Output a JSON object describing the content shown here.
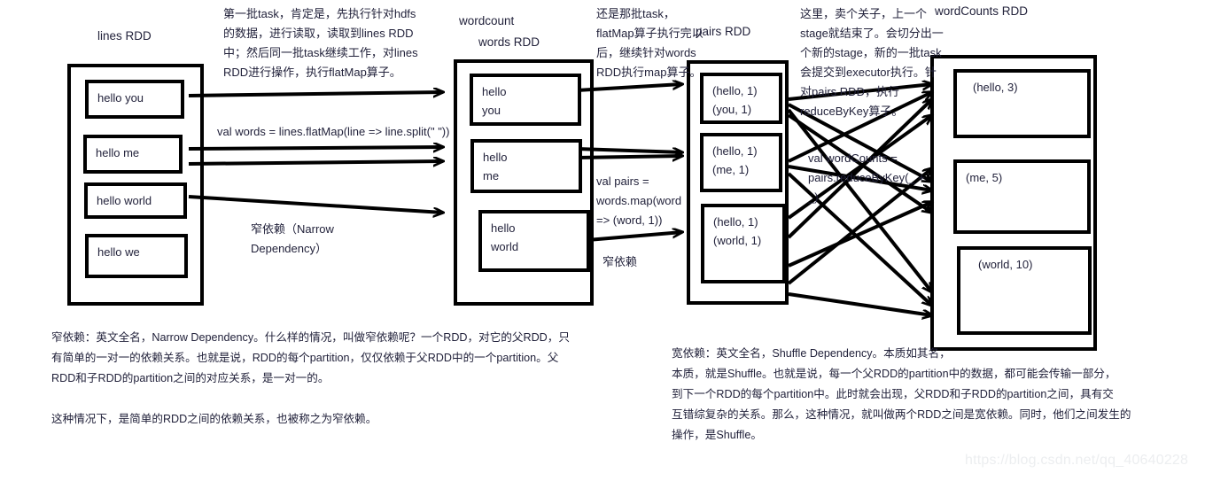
{
  "diagram": {
    "watermark": "https://blog.csdn.net/qq_40640228",
    "titles": {
      "lines_rdd": "lines RDD",
      "wordcount": "wordcount",
      "words_rdd": "words RDD",
      "pairs_rdd": "pairs RDD",
      "wordcounts_rdd": "wordCounts RDD"
    },
    "lines_rdd": {
      "partitions": [
        {
          "lines": [
            "hello you"
          ]
        },
        {
          "lines": [
            "hello me"
          ]
        },
        {
          "lines": [
            "hello world"
          ]
        },
        {
          "lines": [
            "hello we"
          ]
        }
      ]
    },
    "words_rdd": {
      "partitions": [
        {
          "lines": [
            "hello",
            "you"
          ]
        },
        {
          "lines": [
            "hello",
            "me"
          ]
        },
        {
          "lines": [
            "hello",
            "world"
          ]
        }
      ]
    },
    "pairs_rdd": {
      "partitions": [
        {
          "lines": [
            "(hello, 1)",
            "(you, 1)"
          ]
        },
        {
          "lines": [
            "(hello, 1)",
            "(me, 1)"
          ]
        },
        {
          "lines": [
            "(hello, 1)",
            "(world, 1)"
          ]
        }
      ]
    },
    "wordcounts_rdd": {
      "partitions": [
        {
          "lines": [
            "(hello, 3)"
          ]
        },
        {
          "lines": [
            "(me, 5)"
          ]
        },
        {
          "lines": [
            "(world, 10)"
          ]
        }
      ]
    },
    "notes": {
      "note1": [
        "第一批task，肯定是，先执行针对hdfs",
        "的数据，进行读取，读取到lines RDD",
        "中；然后同一批task继续工作，对lines",
        "RDD进行操作，执行flatMap算子。"
      ],
      "note2": [
        "还是那批task，",
        "flatMap算子执行完以",
        "后，继续针对words",
        "RDD执行map算子。"
      ],
      "note3": [
        "这里，卖个关子，上一个",
        "stage就结束了。会切分出一",
        "个新的stage，新的一批task",
        "会提交到executor执行。针",
        "对pairs RDD，执行",
        "reduceByKey算子。"
      ]
    },
    "code": {
      "flatmap": [
        "val words = lines.flatMap(line => line.split(\" \"))"
      ],
      "map": [
        "val pairs =",
        "words.map(word",
        "=> (word, 1))"
      ],
      "reduce": [
        "val wordCounts =",
        "pairs.reduceByKey(_ +",
        "_)"
      ]
    },
    "dependency_labels": {
      "narrow_full": [
        "窄依赖（Narrow",
        "Dependency）"
      ],
      "narrow_short": [
        "窄依赖"
      ]
    },
    "paragraphs": {
      "narrow": [
        "窄依赖：英文全名，Narrow Dependency。什么样的情况，叫做窄依赖呢？一个RDD，对它的父RDD，只",
        "有简单的一对一的依赖关系。也就是说，RDD的每个partition，仅仅依赖于父RDD中的一个partition。父",
        "RDD和子RDD的partition之间的对应关系，是一对一的。",
        "",
        "这种情况下，是简单的RDD之间的依赖关系，也被称之为窄依赖。"
      ],
      "shuffle": [
        "宽依赖：英文全名，Shuffle Dependency。本质如其名，",
        "本质，就是Shuffle。也就是说，每一个父RDD的partition中的数据，都可能会传输一部分，",
        "到下一个RDD的每个partition中。此时就会出现，父RDD和子RDD的partition之间，具有交",
        "互错综复杂的关系。那么，这种情况，就叫做两个RDD之间是宽依赖。同时，他们之间发生的",
        "操作，是Shuffle。"
      ]
    }
  }
}
